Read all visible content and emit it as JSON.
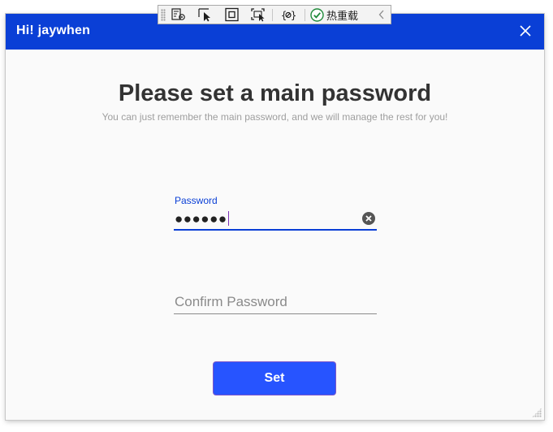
{
  "window": {
    "title": "Hi!  jaywhen",
    "close_icon": "close-icon"
  },
  "debug_toolbar": {
    "buttons": [
      "live-visual-tree-icon",
      "select-element-icon",
      "display-layout-adorners-icon",
      "track-focus-icon",
      "binding-failures-icon"
    ],
    "hot_reload_label": "热重载",
    "hot_reload_icon": "check-circle-icon",
    "collapse_icon": "chevron-left-icon"
  },
  "main": {
    "heading": "Please set a main password",
    "subheading": "You can just remember the main password, and we will manage the rest for you!"
  },
  "password_field": {
    "label": "Password",
    "masked_value": "●●●●●●",
    "clear_icon": "clear-circle-icon"
  },
  "confirm_field": {
    "placeholder": "Confirm Password",
    "value": ""
  },
  "set_button": {
    "label": "Set"
  },
  "colors": {
    "accent": "#0a3fd6",
    "button": "#2754ff",
    "background": "#fafafa",
    "heading": "#333333"
  }
}
